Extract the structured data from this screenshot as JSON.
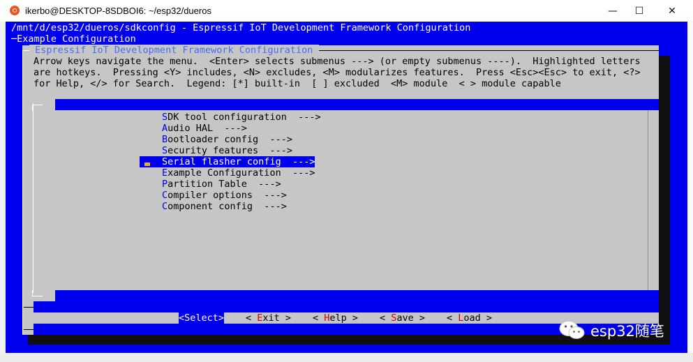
{
  "window": {
    "title": "ikerbo@DESKTOP-8SDBOI6: ~/esp32/dueros",
    "minimize_glyph": "—",
    "maximize_glyph": "☐",
    "close_glyph": "✕",
    "app_icon": "ubuntu-icon"
  },
  "terminal": {
    "path_line": "/mnt/d/esp32/dueros/sdkconfig - Espressif IoT Development Framework Configuration",
    "breadcrumb": "─Example Configuration",
    "dialog_title": " Espressif IoT Development Framework Configuration ",
    "help_lines": [
      "Arrow keys navigate the menu.  <Enter> selects submenus ---> (or empty submenus ----).  Highlighted letters",
      "are hotkeys.  Pressing <Y> includes, <N> excludes, <M> modularizes features.  Press <Esc><Esc> to exit, <?>",
      "for Help, </> for Search.  Legend: [*] built-in  [ ] excluded  <M> module  < > module capable"
    ]
  },
  "menu": {
    "items": [
      {
        "hotkey": "S",
        "rest": "DK tool configuration  --->",
        "selected": false
      },
      {
        "hotkey": "A",
        "rest": "udio HAL  --->",
        "selected": false
      },
      {
        "hotkey": "B",
        "rest": "ootloader config  --->",
        "selected": false
      },
      {
        "hotkey": "S",
        "rest": "ecurity features  --->",
        "selected": false
      },
      {
        "hotkey": "S",
        "rest": "erial flasher config  --->",
        "selected": true
      },
      {
        "hotkey": "E",
        "rest": "xample Configuration  --->",
        "selected": false
      },
      {
        "hotkey": "P",
        "rest": "artition Table  --->",
        "selected": false
      },
      {
        "hotkey": "C",
        "rest": "ompiler options  --->",
        "selected": false
      },
      {
        "hotkey": "C",
        "rest": "omponent config  --->",
        "selected": false
      }
    ]
  },
  "buttons": [
    {
      "pre": "<",
      "hotkey": "S",
      "rest": "elect>",
      "active": true
    },
    {
      "pre": "< ",
      "hotkey": "E",
      "rest": "xit >",
      "active": false
    },
    {
      "pre": "< ",
      "hotkey": "H",
      "rest": "elp >",
      "active": false
    },
    {
      "pre": "< ",
      "hotkey": "S",
      "rest": "ave >",
      "active": false
    },
    {
      "pre": "< ",
      "hotkey": "L",
      "rest": "oad >",
      "active": false
    }
  ],
  "watermark": {
    "text": "esp32随笔",
    "icon": "wechat-icon"
  },
  "colors": {
    "terminal_blue": "#0000ee",
    "dialog_gray": "#c6c6c6",
    "hotkey_blue": "#0000ee",
    "button_hotkey_red": "#cc0000"
  }
}
